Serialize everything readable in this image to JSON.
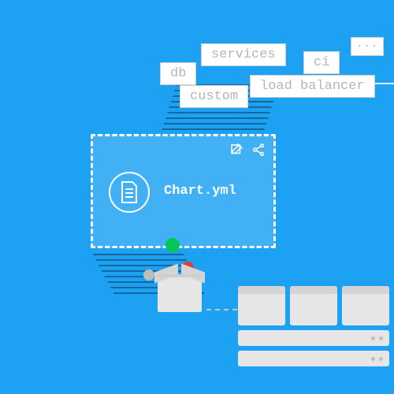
{
  "tags": {
    "db": "db",
    "services": "services",
    "ci": "ci",
    "custom": "custom",
    "load_balancer": "load balancer",
    "ellipsis": "..."
  },
  "chart_card": {
    "title": "Chart.yml"
  }
}
